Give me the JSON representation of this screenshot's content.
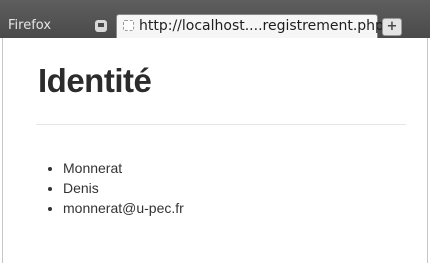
{
  "browser": {
    "app_name": "Firefox",
    "tab": {
      "title": "http://localhost....registrement.php"
    },
    "new_tab_label": "+"
  },
  "page": {
    "heading": "Identité",
    "items": [
      {
        "text": "Monnerat"
      },
      {
        "text": "Denis"
      },
      {
        "text": "monnerat@u-pec.fr"
      }
    ]
  }
}
